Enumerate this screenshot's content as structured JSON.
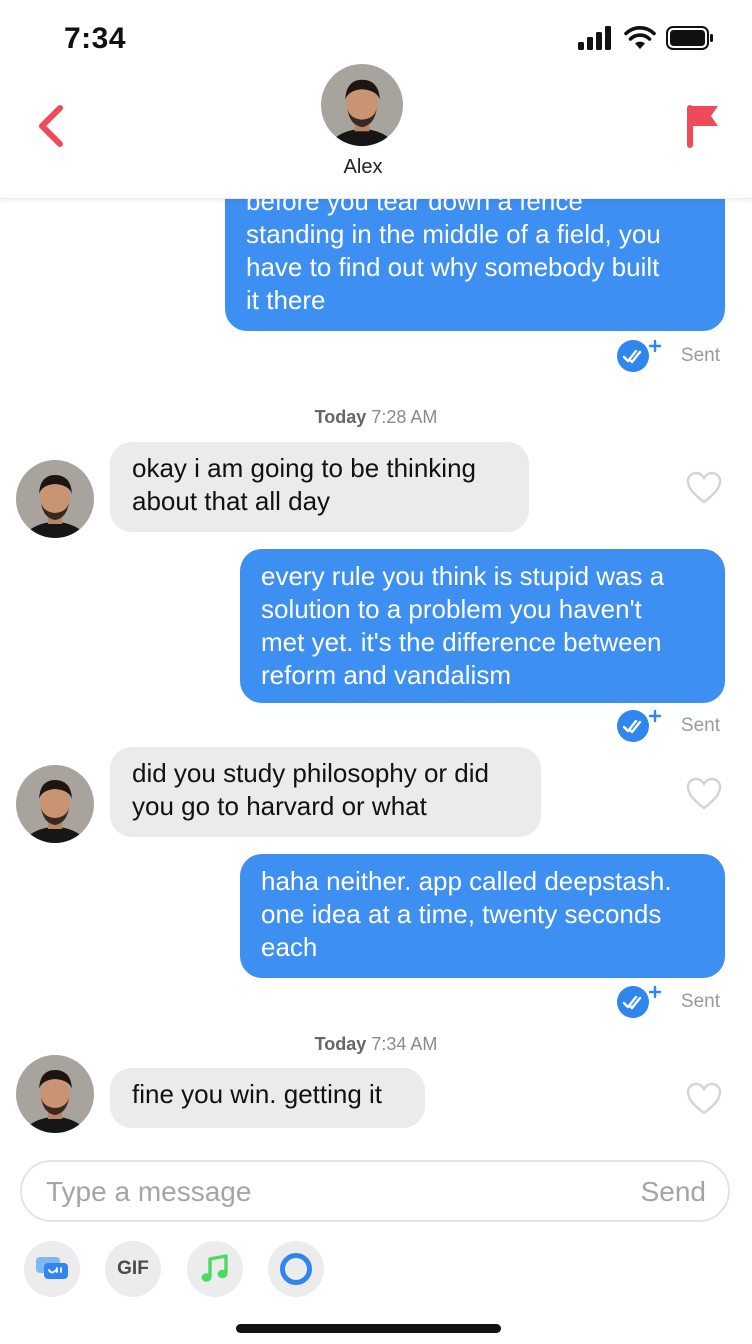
{
  "status_bar": {
    "time": "7:34"
  },
  "header": {
    "contact_name": "Alex",
    "accent": "#ef4a5a"
  },
  "messages": [
    {
      "dir": "out",
      "lines": [
        "before you tear down a fence",
        "standing in the middle of a field, you",
        "have to find out why somebody built",
        "it there"
      ],
      "status": "Sent"
    },
    {
      "timestamp_day": "Today",
      "timestamp_time": "7:28 AM"
    },
    {
      "dir": "in",
      "lines": [
        "okay i am going to be thinking",
        "about that all day"
      ]
    },
    {
      "dir": "out",
      "lines": [
        "every rule you think is stupid was a",
        "solution to a problem you haven't",
        "met yet. it's the difference between",
        "reform and vandalism"
      ],
      "status": "Sent"
    },
    {
      "dir": "in",
      "lines": [
        "did you study philosophy or did",
        "you go to harvard or what"
      ]
    },
    {
      "dir": "out",
      "lines": [
        "haha neither. app called deepstash.",
        "one idea at a time, twenty seconds",
        "each"
      ],
      "status": "Sent"
    },
    {
      "timestamp_day": "Today",
      "timestamp_time": "7:34 AM"
    },
    {
      "dir": "in",
      "lines": [
        "fine you win. getting it"
      ]
    }
  ],
  "composer": {
    "placeholder": "Type a message",
    "send_label": "Send"
  },
  "toolbar": {
    "gif_label": "GIF"
  },
  "colors": {
    "outgoing_bubble": "#3d8ff2",
    "incoming_bubble": "#ebebeb",
    "read_check": "#2f86ee",
    "music": "#4cd964"
  }
}
